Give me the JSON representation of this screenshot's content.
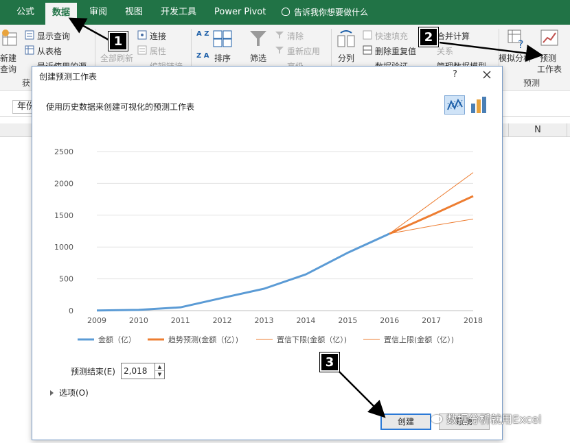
{
  "ribbon": {
    "tabs": [
      "公式",
      "数据",
      "审阅",
      "视图",
      "开发工具",
      "Power Pivot"
    ],
    "active_tab": "数据",
    "tell_me": "告诉我你想要做什么",
    "get_group": {
      "new_query_l1": "新建",
      "new_query_l2": "查询",
      "show_queries": "显示查询",
      "from_table": "从表格",
      "recent_sources": "最近使用的源",
      "group_label_partial": "获"
    },
    "conn_group": {
      "refresh_all": "全部刷新",
      "connections": "连接",
      "properties": "属性",
      "edit_links": "编辑链接"
    },
    "sort_group": {
      "sort": "排序",
      "az": "A Z",
      "za": "Z A"
    },
    "filter_group": {
      "filter": "筛选",
      "clear": "清除",
      "reapply": "重新应用",
      "advanced": "高级"
    },
    "tools_group": {
      "text_to_columns": "分列",
      "flash_fill": "快速填充",
      "remove_duplicates": "删除重复值",
      "data_validation": "数据验证",
      "consolidate": "合并计算",
      "relationships": "关系",
      "manage_model": "管理数据模型"
    },
    "forecast_group": {
      "what_if": "模拟分析",
      "forecast_sheet_l1": "预测",
      "forecast_sheet_l2": "工作表",
      "group_label": "预测"
    }
  },
  "sheet": {
    "name_box": "年份",
    "column_header": "N"
  },
  "dialog": {
    "title": "创建预测工作表",
    "help": "?",
    "description": "使用历史数据来创建可视化的预测工作表",
    "forecast_end_label": "预测结束(E)",
    "forecast_end_value": "2,018",
    "options_label": "选项(O)",
    "create_label": "创建",
    "cancel_label": "取消"
  },
  "chart_data": {
    "type": "line",
    "x": [
      2009,
      2010,
      2011,
      2012,
      2013,
      2014,
      2015,
      2016,
      2017,
      2018
    ],
    "xlim": [
      2009,
      2018
    ],
    "ylim": [
      0,
      2500
    ],
    "yticks": [
      0,
      500,
      1000,
      1500,
      2000,
      2500
    ],
    "grid": true,
    "legend_position": "bottom",
    "series": [
      {
        "name": "金额（亿）",
        "x": [
          2009,
          2010,
          2011,
          2012,
          2013,
          2014,
          2015,
          2016
        ],
        "values": [
          3,
          12,
          52,
          200,
          345,
          570,
          910,
          1210
        ],
        "color": "#5b9bd5",
        "width": 3
      },
      {
        "name": "趋势预测(金额（亿）)",
        "x": [
          2016,
          2017,
          2018
        ],
        "values": [
          1210,
          1500,
          1800
        ],
        "color": "#ed7d31",
        "width": 3
      },
      {
        "name": "置信下限(金额（亿）)",
        "x": [
          2016,
          2017,
          2018
        ],
        "values": [
          1210,
          1330,
          1440
        ],
        "color": "#ed7d31",
        "width": 1
      },
      {
        "name": "置信上限(金额（亿）)",
        "x": [
          2016,
          2017,
          2018
        ],
        "values": [
          1210,
          1690,
          2170
        ],
        "color": "#ed7d31",
        "width": 1
      }
    ]
  },
  "annotations": {
    "step1": "1",
    "step2": "2",
    "step3": "3"
  },
  "watermark": "数据分析就用Excel",
  "colors": {
    "accent": "#217346",
    "series_actual": "#5b9bd5",
    "series_forecast": "#ed7d31"
  }
}
